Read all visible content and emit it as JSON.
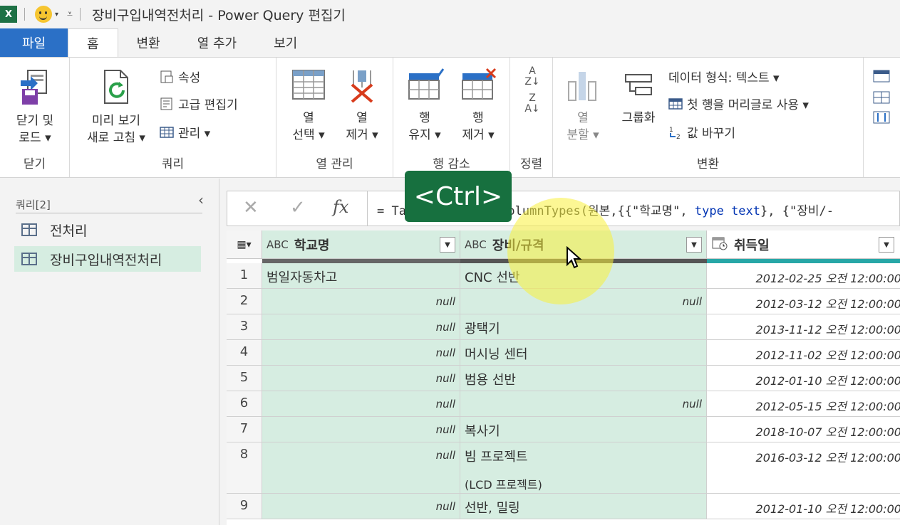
{
  "titlebar": {
    "app_icon_text": "X",
    "title": "장비구입내역전처리 - Power Query 편집기"
  },
  "tabs": [
    {
      "label": "파일"
    },
    {
      "label": "홈"
    },
    {
      "label": "변환"
    },
    {
      "label": "열 추가"
    },
    {
      "label": "보기"
    }
  ],
  "ribbon": {
    "close": {
      "btn": "닫기 및\n로드 ▾",
      "group": "닫기"
    },
    "query": {
      "refresh": "미리 보기\n새로 고침 ▾",
      "props": "속성",
      "advanced": "고급 편집기",
      "manage": "관리 ▾",
      "group": "쿼리"
    },
    "cols": {
      "choose": "열\n선택 ▾",
      "remove": "열\n제거 ▾",
      "group": "열 관리"
    },
    "rows": {
      "keep": "행\n유지 ▾",
      "remove": "행\n제거 ▾",
      "group": "행 감소"
    },
    "sort": {
      "group": "정렬"
    },
    "transform": {
      "split": "열\n분할 ▾",
      "groupby": "그룹화",
      "dtype": "데이터 형식: 텍스트 ▾",
      "header": "첫 행을 머리글로 사용 ▾",
      "replace": "값 바꾸기",
      "group": "변환"
    }
  },
  "queries": {
    "header": "쿼리[2]",
    "items": [
      "전처리",
      "장비구입내역전처리"
    ],
    "selected": "장비구입내역전처리"
  },
  "formula": {
    "prefix": "= Ta",
    "func": "mColumnTypes(원본,{{\"학교명\", ",
    "kw1": "type",
    "kw2": "text",
    "rest": "}, {\"장비/-"
  },
  "columns": [
    {
      "type_icon": "ABC",
      "name": "학교명"
    },
    {
      "type_icon": "ABC",
      "name": "장비/규격"
    },
    {
      "type_icon": "date-time-icon",
      "name": "취득일"
    }
  ],
  "rows": [
    {
      "n": "1",
      "school": "범일자동차고",
      "equip": "CNC 선반",
      "date": "2012-02-25 오전 12:00:00"
    },
    {
      "n": "2",
      "school": "null",
      "equip": "null",
      "date": "2012-03-12 오전 12:00:00"
    },
    {
      "n": "3",
      "school": "null",
      "equip": "광택기",
      "date": "2013-11-12 오전 12:00:00"
    },
    {
      "n": "4",
      "school": "null",
      "equip": "머시닝 센터",
      "date": "2012-11-02 오전 12:00:00"
    },
    {
      "n": "5",
      "school": "null",
      "equip": "범용 선반",
      "date": "2012-01-10 오전 12:00:00"
    },
    {
      "n": "6",
      "school": "null",
      "equip": "null",
      "date": "2012-05-15 오전 12:00:00"
    },
    {
      "n": "7",
      "school": "null",
      "equip": "복사기",
      "date": "2018-10-07 오전 12:00:00"
    },
    {
      "n": "8",
      "school": "null",
      "equip": "빔 프로젝트",
      "equip2": "(LCD 프로젝트)",
      "date": "2016-03-12 오전 12:00:00"
    },
    {
      "n": "9",
      "school": "null",
      "equip": "선반, 밀링",
      "date": "2012-01-10 오전 12:00:00"
    }
  ],
  "overlay": {
    "key": "<Ctrl>"
  },
  "colors": {
    "teal": "#d6ede1",
    "file_tab": "#2b70c6",
    "ctrl_bg": "#17703f",
    "qbar": "#27a7a7"
  }
}
